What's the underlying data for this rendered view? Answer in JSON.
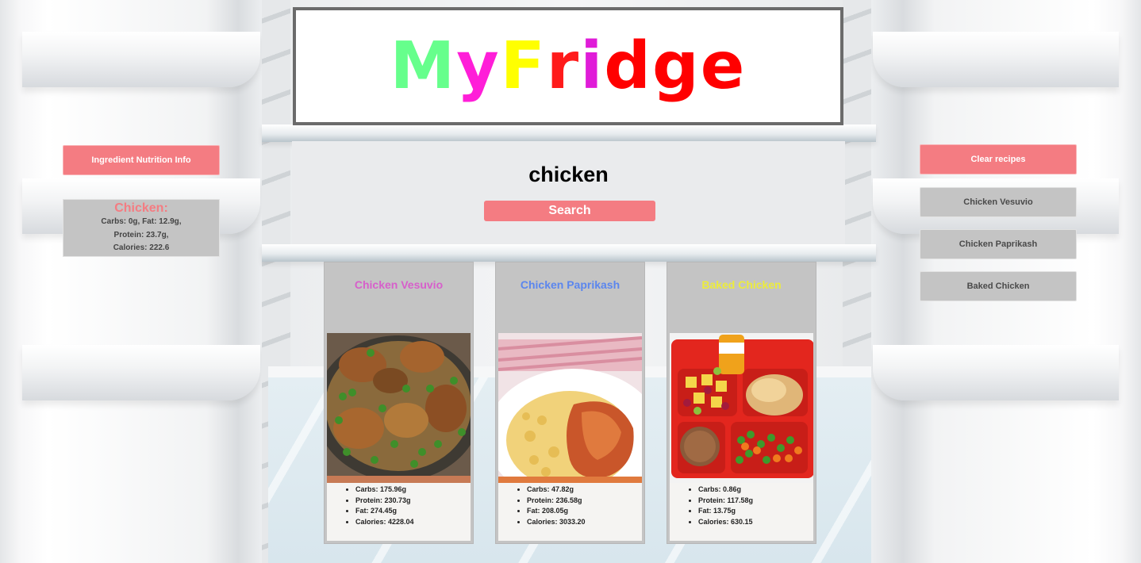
{
  "header": {
    "logo_letters": [
      {
        "char": "M",
        "color": "#66ff8c"
      },
      {
        "char": "y",
        "color": "#ff1ed8"
      },
      {
        "char": "F",
        "color": "#ffff00"
      },
      {
        "char": "r",
        "color": "#ff1a1a"
      },
      {
        "char": "i",
        "color": "#e01cd8"
      },
      {
        "char": "d",
        "color": "#ff0000"
      },
      {
        "char": "g",
        "color": "#ff0000"
      },
      {
        "char": "e",
        "color": "#ff0000"
      }
    ]
  },
  "search": {
    "term": "chicken",
    "button_label": "Search"
  },
  "left_panel": {
    "nutrition_button_label": "Ingredient Nutrition Info",
    "ingredient": {
      "title": "Chicken:",
      "line1": "Carbs: 0g, Fat: 12.9g,",
      "line2": "Protein: 23.7g,",
      "line3": "Calories: 222.6"
    }
  },
  "right_panel": {
    "clear_button_label": "Clear recipes",
    "saved_recipes": [
      {
        "label": "Chicken Vesuvio"
      },
      {
        "label": "Chicken Paprikash"
      },
      {
        "label": "Baked Chicken"
      }
    ]
  },
  "recipes": [
    {
      "title": "Chicken Vesuvio",
      "title_color": "#d75fcb",
      "image": "chicken-vesuvio-photo",
      "carbs": "Carbs: 175.96g",
      "protein": "Protein: 230.73g",
      "fat": "Fat: 274.45g",
      "calories": "Calories: 4228.04"
    },
    {
      "title": "Chicken Paprikash",
      "title_color": "#5b86ee",
      "image": "chicken-paprikash-photo",
      "carbs": "Carbs: 47.82g",
      "protein": "Protein: 236.58g",
      "fat": "Fat: 208.05g",
      "calories": "Calories: 3033.20"
    },
    {
      "title": "Baked Chicken",
      "title_color": "#ecec3c",
      "image": "baked-chicken-tray-photo",
      "carbs": "Carbs: 0.86g",
      "protein": "Protein: 117.58g",
      "fat": "Fat: 13.75g",
      "calories": "Calories: 630.15"
    }
  ],
  "colors": {
    "accent": "#f47c82",
    "card_gray": "#c4c4c4"
  }
}
